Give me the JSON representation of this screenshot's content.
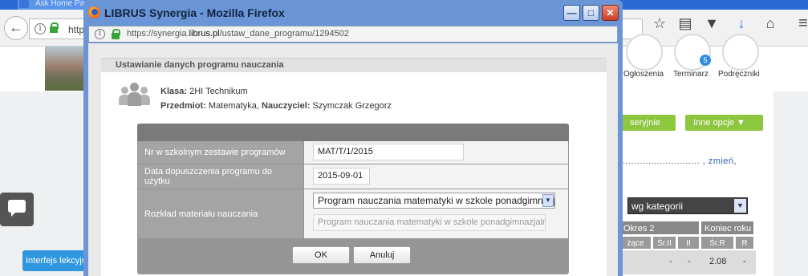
{
  "background_browser": {
    "tab_title": "Ask Home Pa",
    "url_fragment": "http",
    "icons": [
      "back-arrow-icon",
      "info-icon",
      "lock-icon",
      "bookmark-star-icon",
      "reading-list-icon",
      "pocket-icon",
      "download-icon",
      "home-icon",
      "menu-icon"
    ],
    "nav": {
      "ogloszenia": "Ogłoszenia",
      "terminarz": "Terminarz",
      "terminarz_badge": "5",
      "podreczniki": "Podręczniki"
    },
    "green_tab_left": "seryjnie",
    "green_tab_right": "Inne opcje ▼",
    "dots_text": "........................... ,",
    "zmien_link": "zmień",
    "zmien_suffix": ",",
    "select_value": "wg kategorii",
    "table": {
      "header_okres": "Okres 2",
      "header_koniec": "Koniec roku",
      "sub_headers": [
        "żące",
        "Śr.II",
        "II",
        "Śr.R",
        "R"
      ],
      "row_values": [
        "-",
        "-",
        "2.08",
        "-"
      ]
    },
    "interfejs_button": "Interfejs lekcyjn",
    "accent_color": "#8dc63f"
  },
  "popup": {
    "window_title": "LIBRUS Synergia - Mozilla Firefox",
    "url_prefix": "https://synergia.",
    "url_domain": "librus.pl",
    "url_path": "/ustaw_dane_programu/1294502",
    "section_title": "Ustawianie danych programu nauczania",
    "klasa_label": "Klasa:",
    "klasa_value": "2HI Technikum",
    "przedmiot_label": "Przedmiot:",
    "przedmiot_value": "Matematyka,",
    "nauczyciel_label": "Nauczyciel:",
    "nauczyciel_value": "Szymczak Grzegorz",
    "form": {
      "nr_label": "Nr w szkolnym zestawie programów",
      "nr_value": "MAT/T/1/2015",
      "data_label": "Data dopuszczenia programu do użytku",
      "data_value": "2015-09-01",
      "rozklad_label": "Rozkład materiału nauczania",
      "rozklad_selected": "Program nauczania matematyki w szkole ponadgimnazjalnej",
      "rozklad_second": "Program nauczania matematyki w szkole ponadgimnazjalnej"
    },
    "ok_button": "OK",
    "anuluj_button": "Anuluj"
  }
}
